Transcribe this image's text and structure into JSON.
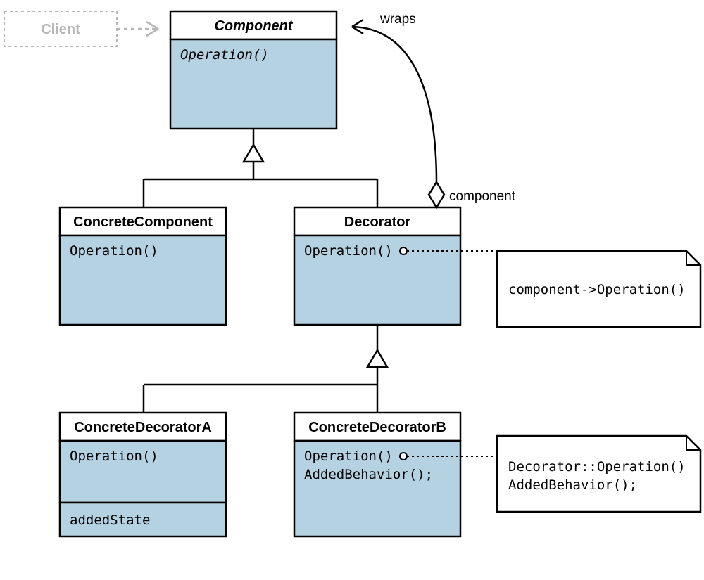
{
  "diagram": {
    "client": {
      "label": "Client"
    },
    "component": {
      "title": "Component",
      "operation": "Operation()"
    },
    "concreteComponent": {
      "title": "ConcreteComponent",
      "operation": "Operation()"
    },
    "decorator": {
      "title": "Decorator",
      "operation": "Operation()"
    },
    "concreteDecoratorA": {
      "title": "ConcreteDecoratorA",
      "operation": "Operation()",
      "state": "addedState"
    },
    "concreteDecoratorB": {
      "title": "ConcreteDecoratorB",
      "operation": "Operation()",
      "behavior": "AddedBehavior();"
    },
    "note1": {
      "line1": "component->Operation()"
    },
    "note2": {
      "line1": "Decorator::Operation()",
      "line2": "AddedBehavior();"
    },
    "labels": {
      "wraps": "wraps",
      "component": "component"
    }
  },
  "colors": {
    "headerFill": "#ffffff",
    "bodyFill": "#b5d2e3",
    "stroke": "#000000",
    "grey": "#b6b6b6"
  }
}
